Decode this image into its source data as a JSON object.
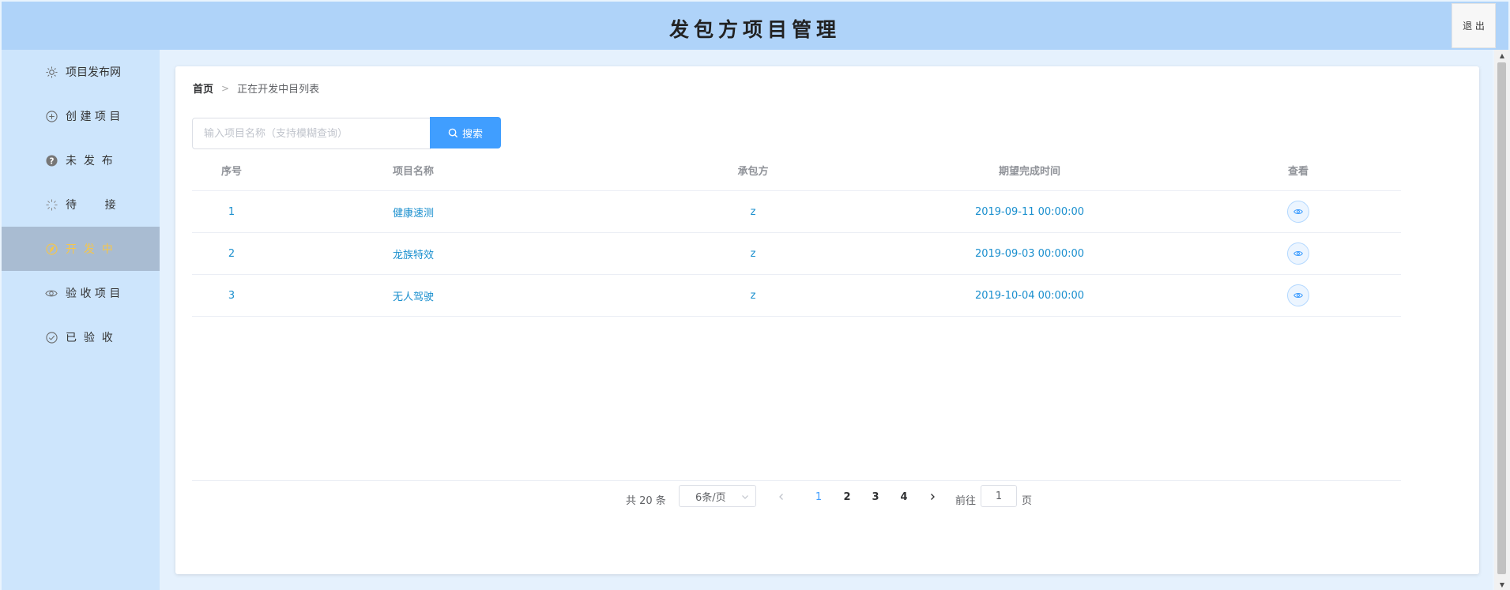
{
  "header": {
    "title": "发包方项目管理",
    "logout_label": "退 出"
  },
  "sidebar": {
    "items": [
      {
        "label": "项目发布网",
        "icon": "sun-icon"
      },
      {
        "label": "创 建 项 目",
        "icon": "plus-circle-icon"
      },
      {
        "label": "未  发  布",
        "icon": "question-circle-icon"
      },
      {
        "label": "待        接",
        "icon": "loading-icon"
      },
      {
        "label": "开  发  中",
        "icon": "compass-icon",
        "active": true
      },
      {
        "label": "验 收 项 目",
        "icon": "eye-icon"
      },
      {
        "label": "已  验  收",
        "icon": "check-circle-icon"
      }
    ],
    "active_color": "#f6c64a"
  },
  "breadcrumb": {
    "home": "首页",
    "current": "正在开发中目列表"
  },
  "search": {
    "placeholder": "输入项目名称（支持模糊查询）",
    "value": "",
    "button_label": "搜索"
  },
  "table": {
    "headers": [
      "序号",
      "项目名称",
      "承包方",
      "期望完成时间",
      "查看"
    ],
    "rows": [
      {
        "index": "1",
        "name": "健康速测",
        "contractor": "z",
        "deadline": "2019-09-11 00:00:00"
      },
      {
        "index": "2",
        "name": "龙族特效",
        "contractor": "z",
        "deadline": "2019-09-03 00:00:00"
      },
      {
        "index": "3",
        "name": "无人驾驶",
        "contractor": "z",
        "deadline": "2019-10-04 00:00:00"
      }
    ]
  },
  "pagination": {
    "total_label": "共 20 条",
    "page_size": "6条/页",
    "pages": [
      "1",
      "2",
      "3",
      "4"
    ],
    "current_page": "1",
    "goto_prefix": "前往",
    "goto_value": "1",
    "goto_suffix": "页"
  },
  "colors": {
    "header_bg": "#afd3f9",
    "sidebar_bg": "#cde5fc",
    "accent": "#409eff",
    "link": "#1a8fce"
  }
}
